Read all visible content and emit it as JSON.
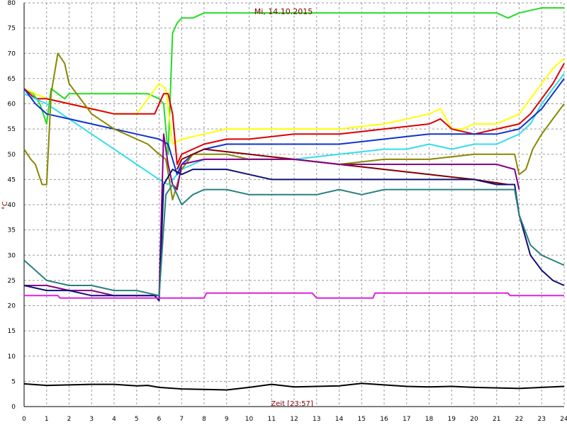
{
  "chart_data": {
    "type": "line",
    "title": "Mi, 14.10.2015",
    "xlabel": "Zeit [23:57]",
    "ylabel": "°C",
    "xlim": [
      0,
      24
    ],
    "ylim": [
      0,
      80
    ],
    "xticks": [
      "0",
      "1",
      "2",
      "3",
      "4",
      "5",
      "6",
      "7",
      "8",
      "9",
      "10",
      "11",
      "12",
      "13",
      "14",
      "15",
      "16",
      "17",
      "18",
      "19",
      "20",
      "21",
      "22",
      "23",
      "24"
    ],
    "yticks": [
      "0",
      "5",
      "10",
      "15",
      "20",
      "25",
      "30",
      "35",
      "40",
      "45",
      "50",
      "55",
      "60",
      "65",
      "70",
      "75",
      "80"
    ],
    "grid": true,
    "series": [
      {
        "color": "#22dd22",
        "x": [
          0,
          0.4,
          0.7,
          1.0,
          1.2,
          1.5,
          1.8,
          2.0,
          2.5,
          3.0,
          4.0,
          5.0,
          5.5,
          6.0,
          6.2,
          6.4,
          6.6,
          6.8,
          7.0,
          7.5,
          8.0,
          10,
          12,
          14,
          16,
          18,
          19,
          20,
          21,
          21.5,
          22,
          23,
          24
        ],
        "y": [
          63,
          62,
          60,
          56,
          63,
          62,
          61,
          62,
          62,
          62,
          62,
          62,
          62,
          61,
          60,
          50,
          74,
          76,
          77,
          77,
          78,
          78,
          78,
          78,
          78,
          78,
          78,
          78,
          78,
          77,
          78,
          79,
          79
        ]
      },
      {
        "color": "#ffff00",
        "x": [
          0,
          1,
          2,
          3,
          4,
          5,
          6,
          6.3,
          6.6,
          7,
          8,
          9,
          10,
          12,
          14,
          16,
          18,
          18.5,
          19,
          19.5,
          20,
          21,
          22,
          22.5,
          23,
          23.5,
          24
        ],
        "y": [
          63,
          61,
          60,
          59,
          58,
          58,
          64,
          63,
          52,
          53,
          54,
          55,
          55,
          55,
          55,
          56,
          58,
          59,
          55,
          55,
          56,
          56,
          58,
          61,
          64,
          67,
          69
        ]
      },
      {
        "color": "#dd0000",
        "x": [
          0,
          0.5,
          1,
          2,
          3,
          4,
          5,
          5.8,
          6.2,
          6.4,
          6.6,
          6.8,
          7,
          7.5,
          8,
          9,
          10,
          12,
          14,
          16,
          18,
          18.5,
          19,
          20,
          21,
          22,
          22.5,
          23,
          23.5,
          24
        ],
        "y": [
          63,
          61,
          61,
          60,
          59,
          58,
          58,
          58,
          62,
          62,
          58,
          48,
          50,
          51,
          52,
          53,
          53,
          54,
          54,
          55,
          56,
          57,
          55,
          54,
          55,
          56,
          58,
          61,
          64,
          68
        ]
      },
      {
        "color": "#33ddee",
        "x": [
          0,
          1,
          2,
          3,
          4,
          5,
          6,
          6.4,
          6.8,
          7,
          7.5,
          8,
          9,
          10,
          12,
          14,
          16,
          17,
          18,
          19,
          20,
          21,
          22,
          22.5,
          23,
          23.5,
          24
        ],
        "y": [
          62,
          60,
          57,
          54,
          51,
          48,
          45,
          44,
          46,
          47,
          48,
          49,
          49,
          49,
          49,
          50,
          51,
          51,
          52,
          51,
          52,
          52,
          54,
          56,
          60,
          63,
          66
        ]
      },
      {
        "color": "#1133cc",
        "x": [
          0,
          0.5,
          1,
          2,
          3,
          4,
          5,
          6,
          6.4,
          6.8,
          7,
          7.5,
          8,
          9,
          10,
          12,
          14,
          16,
          18,
          19,
          20,
          21,
          22,
          22.5,
          23,
          23.5,
          24
        ],
        "y": [
          63,
          60,
          58,
          57,
          56,
          55,
          54,
          53,
          52,
          46,
          48,
          50,
          51,
          52,
          52,
          52,
          52,
          53,
          54,
          54,
          54,
          54,
          55,
          57,
          59,
          62,
          65
        ]
      },
      {
        "color": "#888800",
        "x": [
          0,
          0.3,
          0.5,
          0.8,
          1.0,
          1.2,
          1.5,
          1.8,
          2.0,
          2.5,
          3.0,
          4.0,
          5.0,
          5.5,
          6.0,
          6.3,
          6.6,
          7.0,
          7.5,
          8.0,
          9.0,
          10,
          12,
          14,
          16,
          18,
          20,
          21,
          21.8,
          22,
          22.3,
          22.6,
          23,
          23.5,
          24
        ],
        "y": [
          51,
          49,
          48,
          44,
          44,
          62,
          70,
          68,
          64,
          61,
          58,
          55,
          53,
          52,
          50,
          49,
          41,
          47,
          50,
          50,
          50,
          49,
          49,
          48,
          49,
          49,
          50,
          50,
          50,
          46,
          47,
          51,
          54,
          57,
          60
        ]
      },
      {
        "color": "#800000",
        "x": [
          6.8,
          7,
          8,
          10,
          12,
          14,
          16,
          18,
          20,
          21.5
        ],
        "y": [
          47,
          49,
          51,
          50,
          49,
          48,
          47,
          46,
          45,
          44
        ]
      },
      {
        "color": "#880088",
        "x": [
          0,
          1,
          2,
          3,
          4,
          5,
          6,
          6.2,
          6.4,
          6.6,
          6.8,
          7,
          8,
          9,
          10,
          12,
          14,
          16,
          18,
          19,
          20,
          21,
          21.8,
          22
        ],
        "y": [
          24,
          24,
          23,
          23,
          22,
          22,
          22,
          54,
          48,
          44,
          43,
          48,
          49,
          49,
          49,
          49,
          48,
          48,
          48,
          48,
          48,
          48,
          47,
          43
        ]
      },
      {
        "color": "#111177",
        "x": [
          0,
          1,
          2,
          3,
          4,
          5,
          5.8,
          6.0,
          6.2,
          6.6,
          7,
          7.5,
          8,
          9,
          10,
          11,
          12,
          13,
          14,
          15,
          16,
          17,
          18,
          19,
          20,
          21,
          21.8,
          22,
          22.5,
          23,
          23.5,
          24
        ],
        "y": [
          24,
          23,
          23,
          22,
          22,
          22,
          22,
          21,
          44,
          47,
          46,
          47,
          47,
          47,
          46,
          45,
          45,
          45,
          45,
          45,
          45,
          45,
          45,
          45,
          45,
          44,
          44,
          38,
          30,
          27,
          25,
          24
        ]
      },
      {
        "color": "#2a8080",
        "x": [
          0,
          0.5,
          1,
          2,
          3,
          4,
          5,
          6,
          6.3,
          6.6,
          7,
          7.5,
          8,
          8.5,
          9,
          10,
          11,
          12,
          13,
          14,
          15,
          16,
          17,
          18,
          19,
          20,
          21,
          21.8,
          22,
          22.5,
          23,
          23.5,
          24
        ],
        "y": [
          29,
          27,
          25,
          24,
          24,
          23,
          23,
          22,
          42,
          44,
          40,
          42,
          43,
          43,
          43,
          42,
          42,
          42,
          42,
          43,
          42,
          43,
          43,
          43,
          43,
          43,
          43,
          43,
          38,
          32,
          30,
          29,
          28
        ]
      },
      {
        "color": "#dd22dd",
        "x": [
          0,
          1.5,
          1.6,
          5.8,
          6.0,
          8.0,
          8.1,
          12.8,
          13.0,
          15.5,
          15.6,
          21.5,
          21.6,
          22,
          24
        ],
        "y": [
          22,
          22,
          21.5,
          21.5,
          21.5,
          21.5,
          22.5,
          22.5,
          21.5,
          21.5,
          22.5,
          22.5,
          22,
          22,
          22
        ]
      },
      {
        "color": "#000000",
        "x": [
          0,
          1,
          2,
          3,
          4,
          5,
          5.5,
          6,
          7,
          8,
          9,
          10,
          11,
          12,
          13,
          14,
          15,
          16,
          17,
          18,
          19,
          20,
          21,
          22,
          23,
          24
        ],
        "y": [
          4.5,
          4.2,
          4.3,
          4.4,
          4.4,
          4.1,
          4.2,
          3.8,
          3.5,
          3.4,
          3.3,
          3.8,
          4.4,
          3.9,
          4.0,
          4.1,
          4.6,
          4.3,
          4.0,
          3.9,
          4.0,
          3.8,
          3.7,
          3.6,
          3.8,
          4.0
        ]
      }
    ]
  }
}
